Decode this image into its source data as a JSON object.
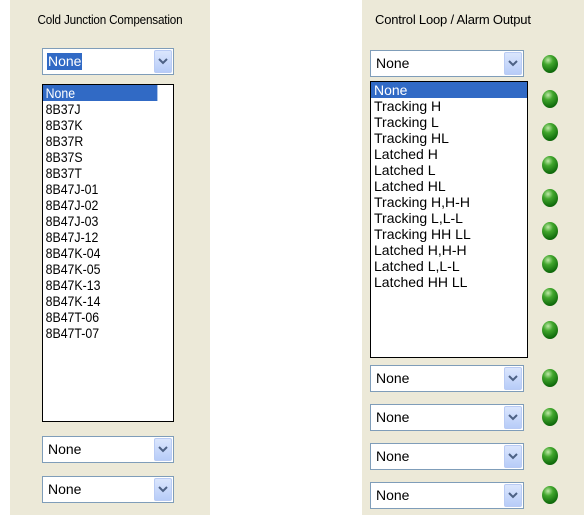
{
  "cold_junction": {
    "header": "Cold Junction Compensation",
    "combo_top_value": "None",
    "dropdown_options": [
      "None",
      "8B37J",
      "8B37K",
      "8B37R",
      "8B37S",
      "8B37T",
      "8B47J-01",
      "8B47J-02",
      "8B47J-03",
      "8B47J-12",
      "8B47K-04",
      "8B47K-05",
      "8B47K-13",
      "8B47K-14",
      "8B47T-06",
      "8B47T-07"
    ],
    "selected_option": "None",
    "lower_combos": [
      "None",
      "None"
    ]
  },
  "control_loop": {
    "header": "Control Loop / Alarm Output",
    "combo_top_value": "None",
    "dropdown_options": [
      "None",
      "Tracking H",
      "Tracking L",
      "Tracking HL",
      "Latched H",
      "Latched L",
      "Latched HL",
      "Tracking H,H-H",
      "Tracking L,L-L",
      "Tracking HH LL",
      "Latched H,H-H",
      "Latched L,L-L",
      "Latched HH LL"
    ],
    "selected_option": "None",
    "lower_combos": [
      "None",
      "None",
      "None",
      "None"
    ],
    "led_color": "#1e8a16",
    "led_count": 12
  }
}
